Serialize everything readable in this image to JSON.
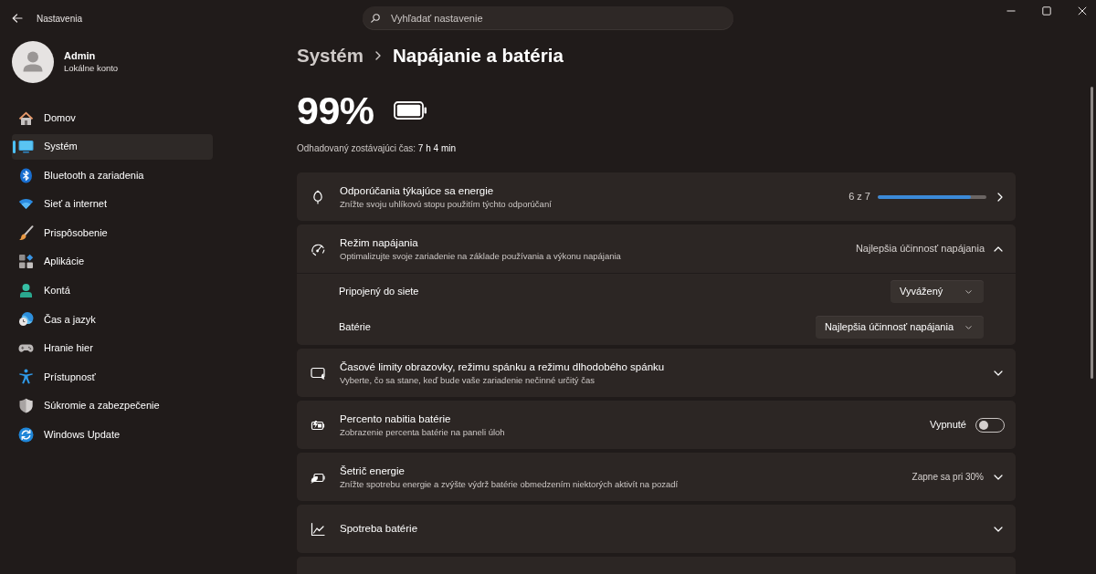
{
  "window": {
    "title": "Nastavenia"
  },
  "search": {
    "placeholder": "Vyhľadať nastavenie"
  },
  "account": {
    "name": "Admin",
    "type": "Lokálne konto"
  },
  "sidebar": {
    "items": [
      {
        "label": "Domov",
        "selected": false
      },
      {
        "label": "Systém",
        "selected": true
      },
      {
        "label": "Bluetooth a zariadenia",
        "selected": false
      },
      {
        "label": "Sieť a internet",
        "selected": false
      },
      {
        "label": "Prispôsobenie",
        "selected": false
      },
      {
        "label": "Aplikácie",
        "selected": false
      },
      {
        "label": "Kontá",
        "selected": false
      },
      {
        "label": "Čas a jazyk",
        "selected": false
      },
      {
        "label": "Hranie hier",
        "selected": false
      },
      {
        "label": "Prístupnosť",
        "selected": false
      },
      {
        "label": "Súkromie a zabezpečenie",
        "selected": false
      },
      {
        "label": "Windows Update",
        "selected": false
      }
    ]
  },
  "breadcrumb": {
    "parent": "Systém",
    "current": "Napájanie a batéria"
  },
  "battery": {
    "percent": "99%",
    "estimate": "Odhadovaný zostávajúci čas: **7 h 4 min**"
  },
  "cards": [
    {
      "kind": "progress",
      "title": "Odporúčania týkajúce sa energie",
      "subtitle": "Znížte svoju uhlíkovú stopu použitím týchto odporúčaní",
      "count": "6 z 7",
      "level": 0.86
    },
    {
      "kind": "expander",
      "title": "Režim napájania",
      "subtitle": "Optimalizujte svoje zariadenie na základe používania a výkonu napájania",
      "value": "Najlepšia účinnosť napájania",
      "expanded": true,
      "rows": [
        {
          "label": "Pripojený do siete",
          "value": "Vyvážený"
        },
        {
          "label": "Batérie",
          "value": "Najlepšia účinnosť napájania"
        }
      ]
    },
    {
      "kind": "expander",
      "title": "Časové limity obrazovky, režimu spánku a režimu dlhodobého spánku",
      "subtitle": "Vyberte, čo sa stane, keď bude vaše zariadenie nečinné určitý čas",
      "expanded": false
    },
    {
      "kind": "toggle",
      "title": "Percento nabitia batérie",
      "subtitle": "Zobrazenie percenta batérie na paneli úloh",
      "state_label": "Vypnuté",
      "on": false
    },
    {
      "kind": "expander",
      "title": "Šetrič energie",
      "subtitle": "Znížte spotrebu energie a zvýšte výdrž batérie obmedzením niektorých aktivít na pozadí",
      "value": "Zapne sa pri 30%",
      "expanded": false
    },
    {
      "kind": "expander",
      "title": "Spotreba batérie",
      "expanded": false
    },
    {
      "kind": "cut_off"
    }
  ]
}
